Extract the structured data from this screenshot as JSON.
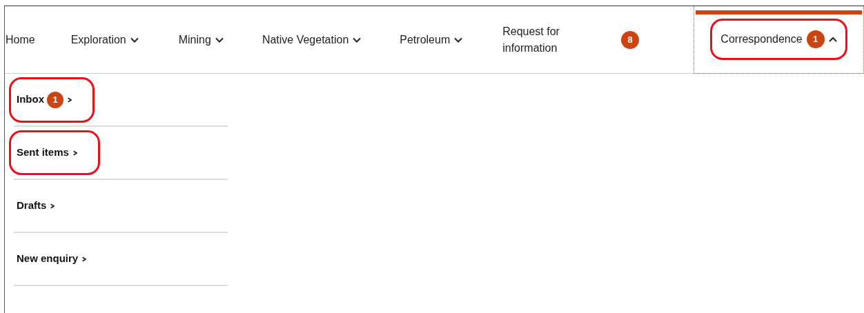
{
  "nav": {
    "items": [
      {
        "label": "Home",
        "kind": "link"
      },
      {
        "label": "Exploration",
        "kind": "dropdown",
        "expanded": false
      },
      {
        "label": "Mining",
        "kind": "dropdown",
        "expanded": false
      },
      {
        "label": "Native Vegetation",
        "kind": "dropdown",
        "expanded": false
      },
      {
        "label": "Petroleum",
        "kind": "dropdown",
        "expanded": false
      },
      {
        "label": "Request for information",
        "kind": "link"
      },
      {
        "label": "8",
        "kind": "badge"
      },
      {
        "label": "Correspondence",
        "kind": "dropdown",
        "badge": "1",
        "expanded": true,
        "selected": true,
        "highlighted": true
      }
    ]
  },
  "menu": {
    "items": [
      {
        "label": "Inbox",
        "badge": "1",
        "highlighted": true
      },
      {
        "label": "Sent items",
        "highlighted": true
      },
      {
        "label": "Drafts",
        "highlighted": false
      },
      {
        "label": "New enquiry",
        "highlighted": false
      }
    ]
  }
}
